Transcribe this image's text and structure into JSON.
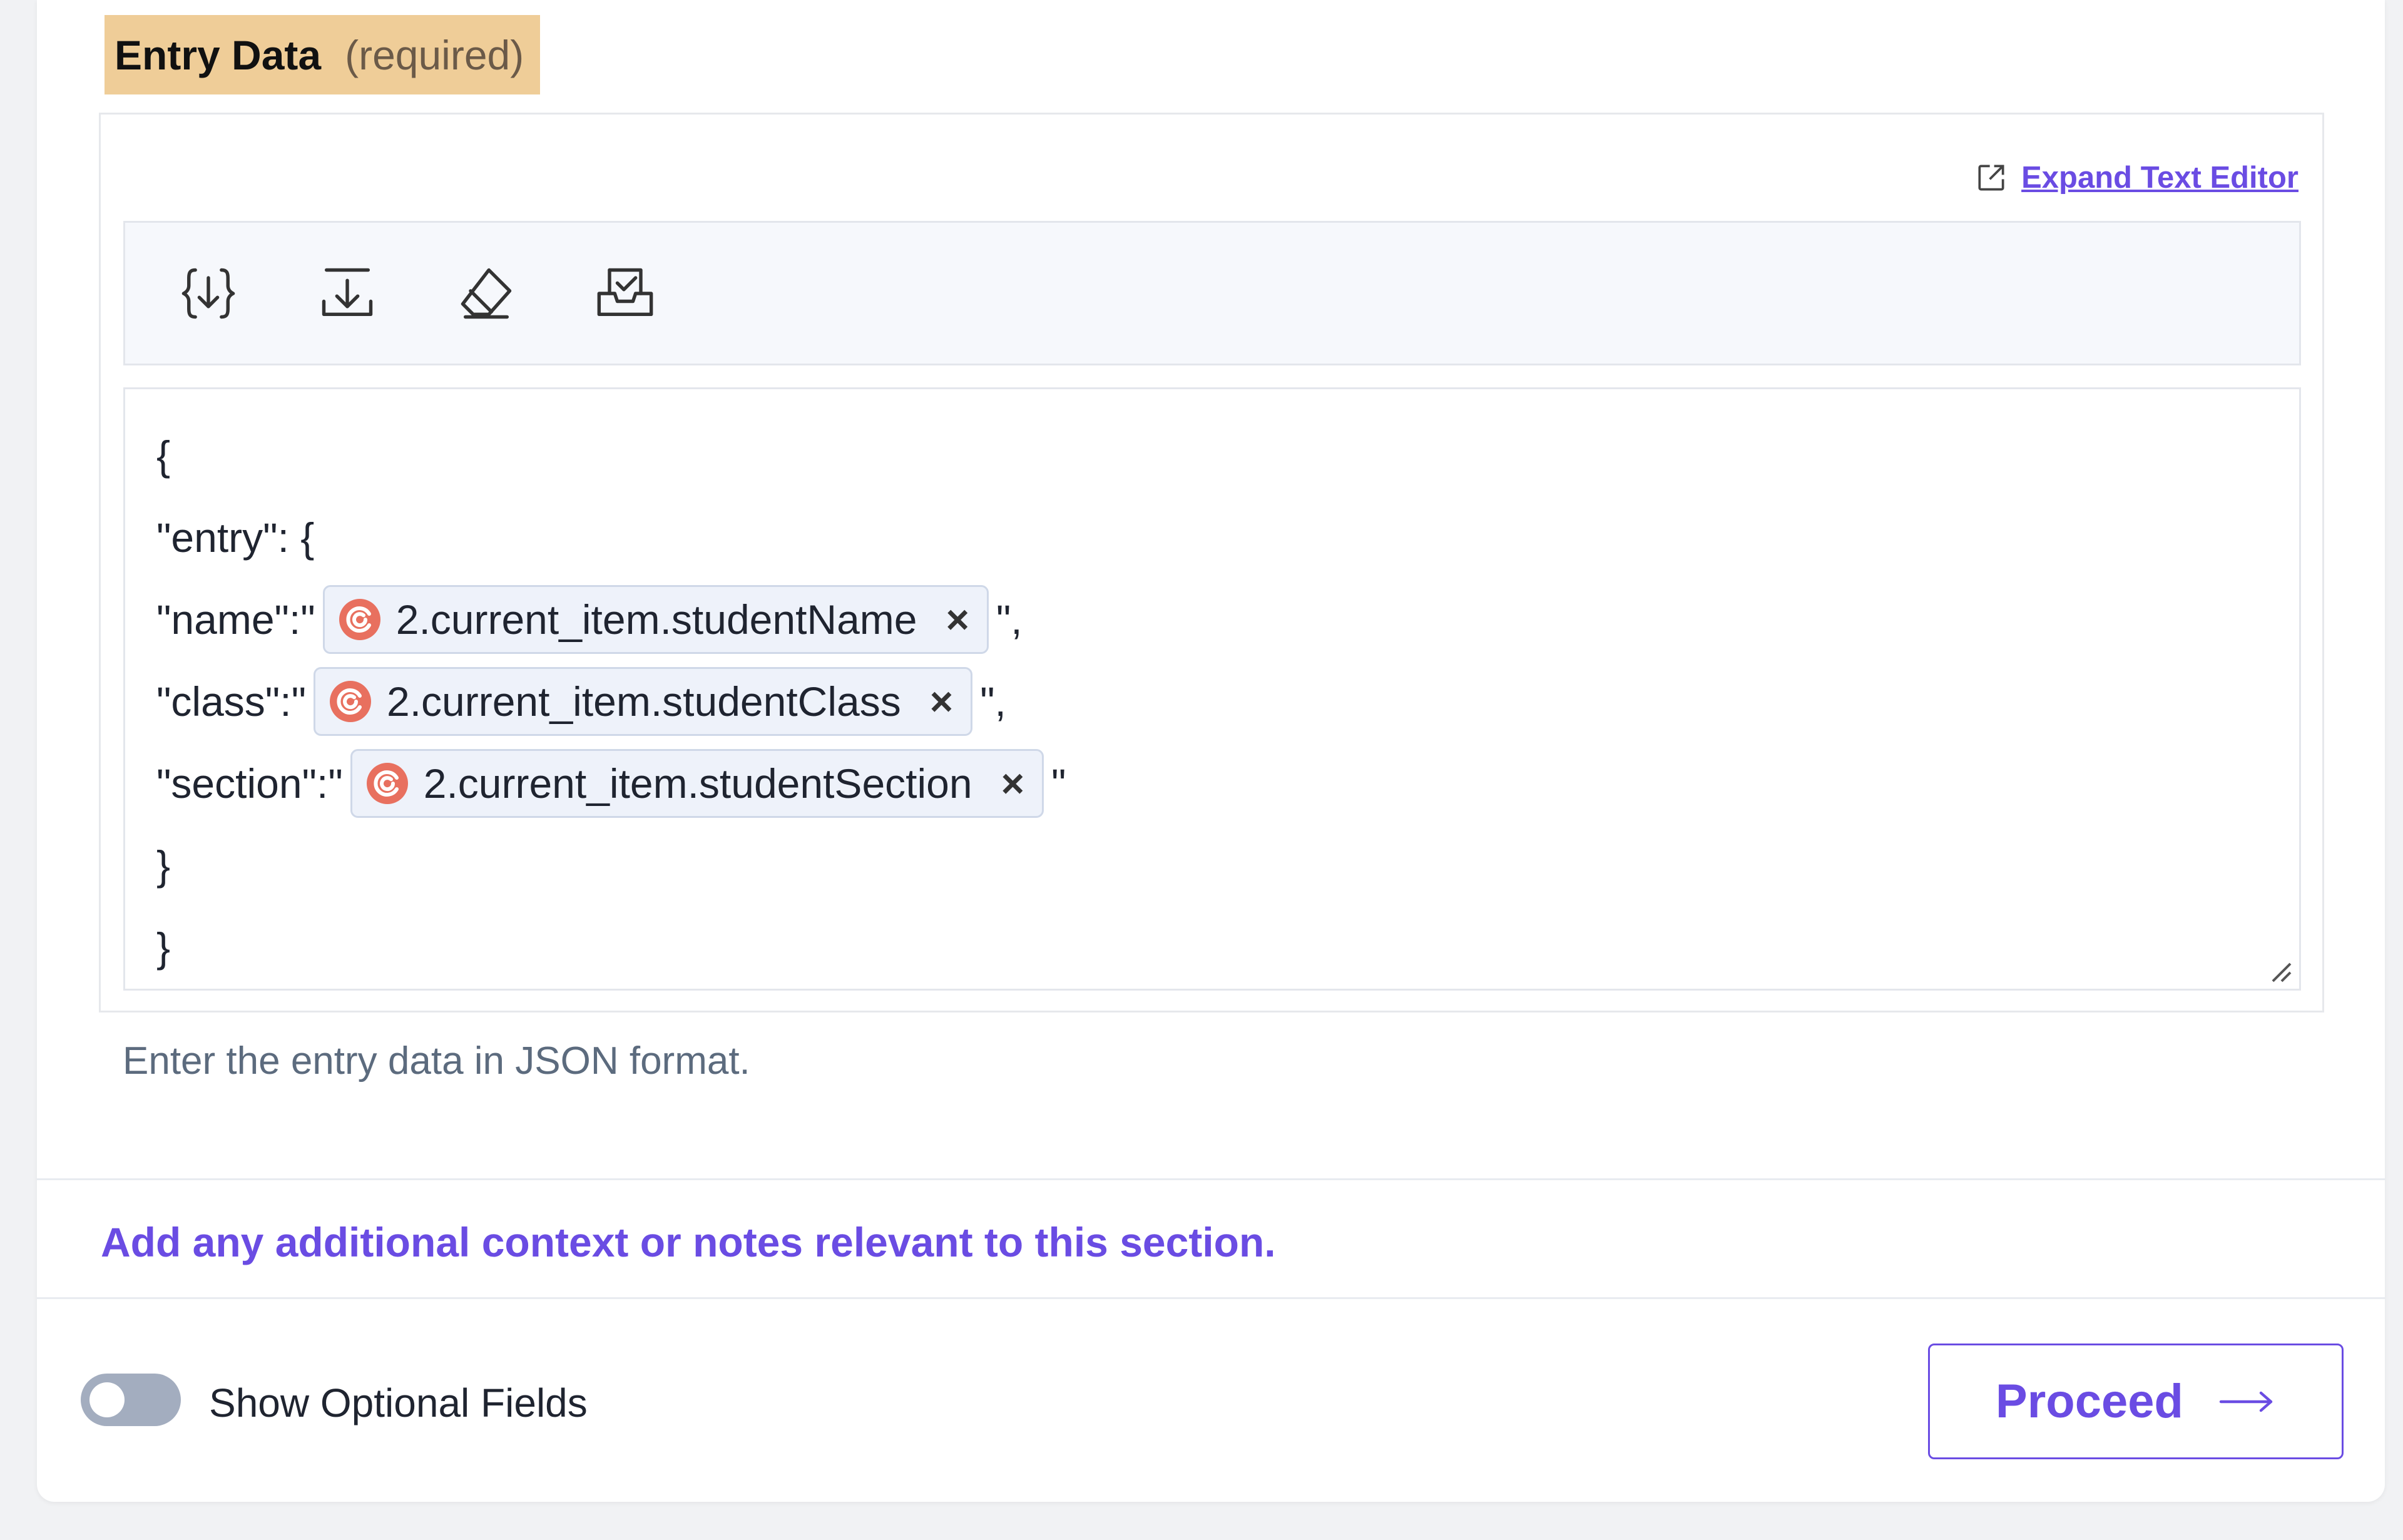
{
  "field": {
    "title": "Entry Data",
    "required_tag": "(required)",
    "expand_label": "Expand Text Editor",
    "helper": "Enter the entry data in JSON format."
  },
  "toolbar": {
    "buttons": [
      {
        "icon": "insert-variable-icon"
      },
      {
        "icon": "download-icon"
      },
      {
        "icon": "eraser-icon"
      },
      {
        "icon": "save-check-icon"
      }
    ]
  },
  "editor": {
    "line1": "{",
    "line2": "\"entry\": {",
    "line3_prefix": "\"name\":\"",
    "line3_chip": "2.current_item.studentName",
    "line3_suffix": "\",",
    "line4_prefix": "\"class\":\"",
    "line4_chip": "2.current_item.studentClass",
    "line4_suffix": "\",",
    "line5_prefix": "\"section\":\"",
    "line5_chip": "2.current_item.studentSection",
    "line5_suffix": "\"",
    "line6": "}",
    "line7": "}",
    "chip_remove": "×"
  },
  "notes": "Add any additional context or notes relevant to this section.",
  "footer": {
    "toggle_label": "Show Optional Fields",
    "proceed_label": "Proceed"
  },
  "colors": {
    "accent": "#6a4ce3",
    "label_bg": "#efcd98",
    "chip_icon": "#e8705f"
  }
}
